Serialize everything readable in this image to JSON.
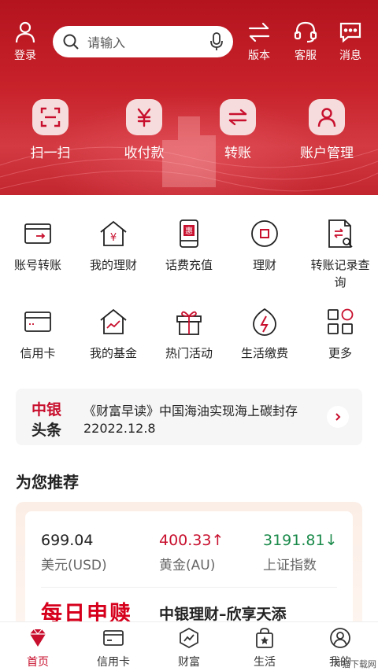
{
  "header": {
    "login_label": "登录",
    "search_placeholder": "请输入",
    "version_label": "版本",
    "service_label": "客服",
    "message_label": "消息",
    "quick_actions": [
      {
        "label": "扫一扫",
        "icon": "scan-icon"
      },
      {
        "label": "收付款",
        "icon": "yuan-icon"
      },
      {
        "label": "转账",
        "icon": "transfer-icon"
      },
      {
        "label": "账户管理",
        "icon": "account-icon"
      }
    ]
  },
  "grid": [
    {
      "label": "账号转账",
      "icon": "card-transfer-icon"
    },
    {
      "label": "我的理财",
      "icon": "wealth-house-icon"
    },
    {
      "label": "话费充值",
      "icon": "phone-topup-icon"
    },
    {
      "label": "理财",
      "icon": "finance-circle-icon"
    },
    {
      "label": "转账记录查询",
      "icon": "transfer-record-icon"
    },
    {
      "label": "信用卡",
      "icon": "credit-card-icon"
    },
    {
      "label": "我的基金",
      "icon": "fund-house-icon"
    },
    {
      "label": "热门活动",
      "icon": "gift-icon"
    },
    {
      "label": "生活缴费",
      "icon": "bill-payment-icon"
    },
    {
      "label": "更多",
      "icon": "more-grid-icon"
    }
  ],
  "news": {
    "brand_line1": "中银",
    "brand_line2": "头条",
    "title": "《财富早读》中国海油实现海上碳封存",
    "date": "22022.12.8"
  },
  "recommend": {
    "title": "为您推荐",
    "rates": [
      {
        "value": "699.04",
        "name": "美元(USD)",
        "trend": "",
        "color": "#222222"
      },
      {
        "value": "400.33↑",
        "name": "黄金(AU)",
        "trend": "up",
        "color": "#c8102e"
      },
      {
        "value": "3191.81↓",
        "name": "上证指数",
        "trend": "down",
        "color": "#1a8a4a"
      }
    ],
    "promo": "每日申赎",
    "promo_sub": "中银理财–欣享天添"
  },
  "tabbar": [
    {
      "label": "首页",
      "icon": "home-diamond-icon",
      "active": true
    },
    {
      "label": "信用卡",
      "icon": "credit-card-tab-icon",
      "active": false
    },
    {
      "label": "财富",
      "icon": "wealth-tab-icon",
      "active": false
    },
    {
      "label": "生活",
      "icon": "life-bag-icon",
      "active": false
    },
    {
      "label": "我的",
      "icon": "profile-icon",
      "active": false
    }
  ],
  "watermark": "IT猫下载网",
  "colors": {
    "brand_red": "#c8102e",
    "header_red": "#c8222b",
    "up": "#c8102e",
    "down": "#1a8a4a"
  }
}
